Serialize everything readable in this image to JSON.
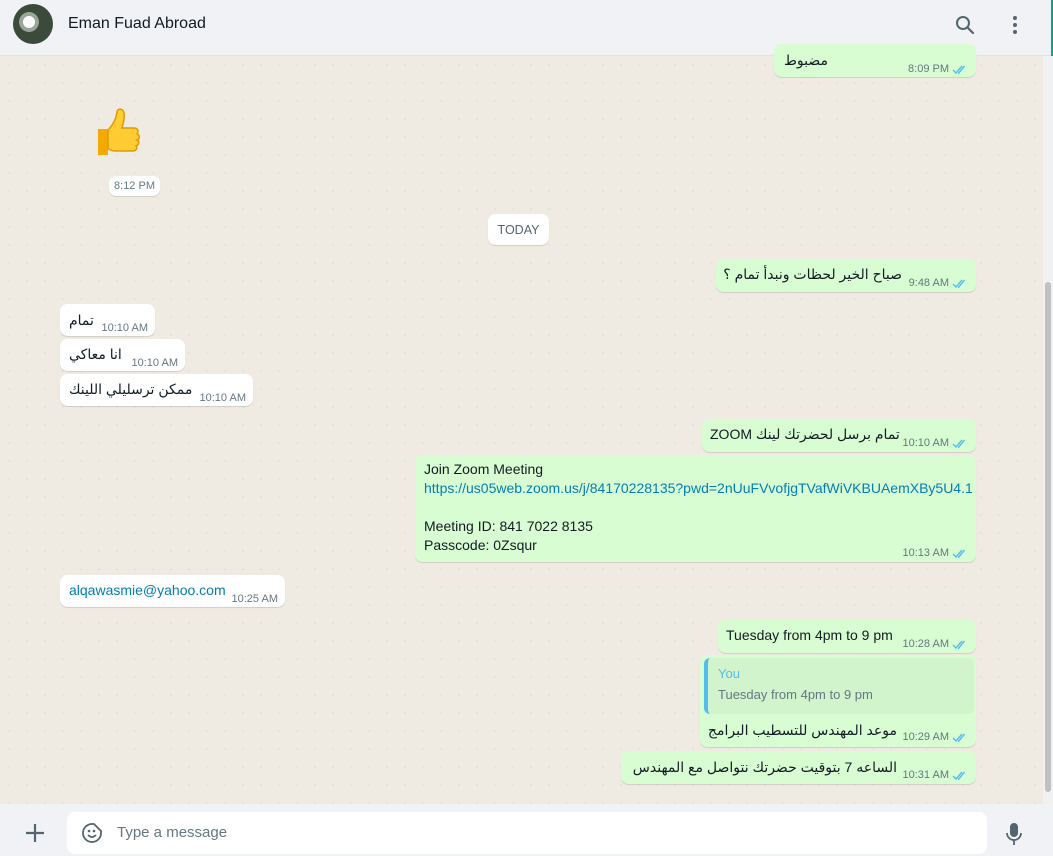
{
  "header": {
    "contact_name": "Eman Fuad Abroad",
    "avatar_icon": "profile-photo",
    "search_icon": "search-icon",
    "menu_icon": "kebab-menu-icon"
  },
  "date_divider": "TODAY",
  "messages": [
    {
      "id": "m0",
      "direction": "out",
      "text": "مضبوط",
      "time": "8:09 PM",
      "status": "read"
    },
    {
      "id": "m1",
      "direction": "in",
      "type": "sticker",
      "emoji": "👍",
      "time": "8:12 PM"
    },
    {
      "id": "m2",
      "direction": "out",
      "text": "صباح الخير لحظات ونبدأ تمام ؟",
      "time": "9:48 AM",
      "status": "read"
    },
    {
      "id": "m3",
      "direction": "in",
      "text": "تمام",
      "time": "10:10 AM"
    },
    {
      "id": "m4",
      "direction": "in",
      "text": "انا معاكي",
      "time": "10:10 AM"
    },
    {
      "id": "m5",
      "direction": "in",
      "text": "ممكن ترسليلي اللينك",
      "time": "10:10 AM"
    },
    {
      "id": "m6",
      "direction": "out",
      "text": "تمام برسل لحضرتك لينك ZOOM",
      "time": "10:10 AM",
      "status": "read"
    },
    {
      "id": "m7",
      "direction": "out",
      "lines": [
        "Join Zoom Meeting",
        "https://us05web.zoom.us/j/84170228135?pwd=2nUuFVvofjgTVafWiVKBUAemXBy5U4.1",
        "Meeting ID: 841 7022 8135",
        "Passcode: 0Zsqur"
      ],
      "time": "10:13 AM",
      "status": "read"
    },
    {
      "id": "m8",
      "direction": "in",
      "text": "alqawasmie@yahoo.com",
      "time": "10:25 AM"
    },
    {
      "id": "m9",
      "direction": "out",
      "text": "Tuesday from 4pm to 9 pm",
      "time": "10:28 AM",
      "status": "read"
    },
    {
      "id": "m10",
      "direction": "out",
      "quote": {
        "author": "You",
        "text": "Tuesday from 4pm to 9 pm"
      },
      "text": "موعد المهندس للتسطيب البرامج",
      "time": "10:29 AM",
      "status": "read"
    },
    {
      "id": "m11",
      "direction": "out",
      "text": "الساعه 7 بتوقيت حضرتك نتواصل مع المهندس",
      "time": "10:31 AM",
      "status": "read"
    }
  ],
  "composer": {
    "placeholder": "Type a message",
    "attach_icon": "plus-icon",
    "emoji_icon": "sticker-smiley-icon",
    "mic_icon": "microphone-icon"
  },
  "colors": {
    "outgoing_bubble": "#d9fdd3",
    "incoming_bubble": "#ffffff",
    "read_ticks": "#53bdeb",
    "link": "#027eb5",
    "accent": "#00a884"
  }
}
